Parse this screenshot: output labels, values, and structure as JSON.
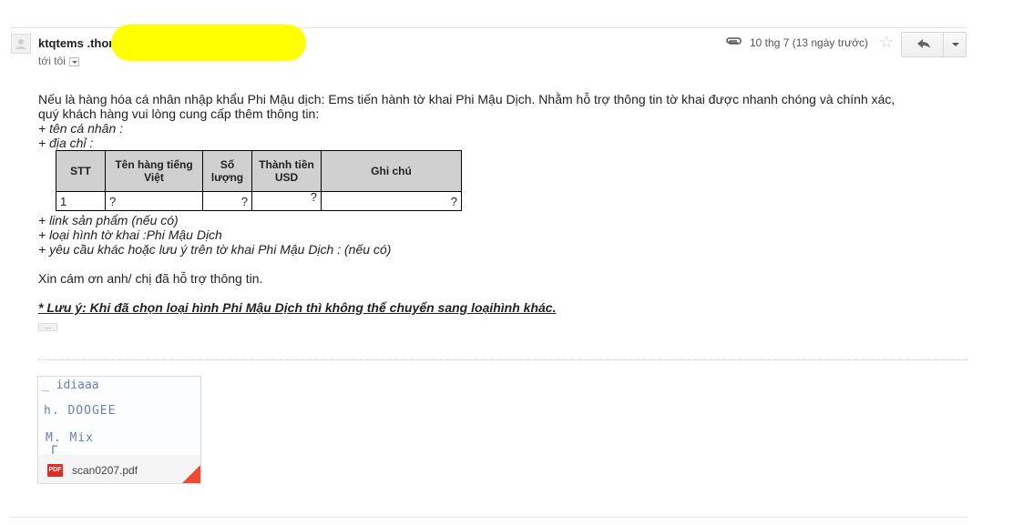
{
  "header": {
    "sender": "ktqtems .thor",
    "recipient": "tới tôi",
    "date": "10 thg 7 (13 ngày trước)",
    "icons": {
      "star": "star-icon",
      "reply": "reply-icon",
      "more": "chevron-down-icon",
      "attachment": "paperclip-icon"
    }
  },
  "body": {
    "intro_line1": "Nếu là hàng hóa cá nhân nhập khẩu Phi Mậu dịch: Ems tiến hành tờ khai Phi Mậu Dịch. Nhằm hỗ trợ thông tin tờ khai được nhanh chóng và chính xác,",
    "intro_line2": "quý khách hàng vui lòng cung cấp thêm thông tin:",
    "item_name": "+ tên cá nhân :",
    "item_address": "+ địa chỉ :",
    "table": {
      "headers": [
        "STT",
        "Tên hàng tiếng Việt",
        "Số lượng",
        "Thành tiền USD",
        "Ghi chú"
      ],
      "row": [
        "1",
        "?",
        "?",
        "?",
        "?"
      ]
    },
    "item_link": "+ link sản phẩm (nếu có)",
    "item_type": "+ loại hình tờ khai :Phi Mậu Dịch",
    "item_request": "+ yêu cầu khác hoặc lưu ý trên tờ khai Phi Mậu Dịch : (nếu có)",
    "thanks": "Xin cám ơn anh/ chị đã hỗ trợ thông tin.",
    "note": "* Lưu ý: Khi đã chọn loại hình Phi Mậu Dịch thì không thể chuyển sang loạihình khác."
  },
  "attachment": {
    "filename": "scan0207.pdf",
    "type_badge": "PDF",
    "preview_lines": [
      "_ idiaaa",
      "h. DOOGEE",
      "M. Mix",
      "Γ"
    ]
  },
  "colors": {
    "redaction": "#ffff00",
    "pdf": "#d93025"
  }
}
